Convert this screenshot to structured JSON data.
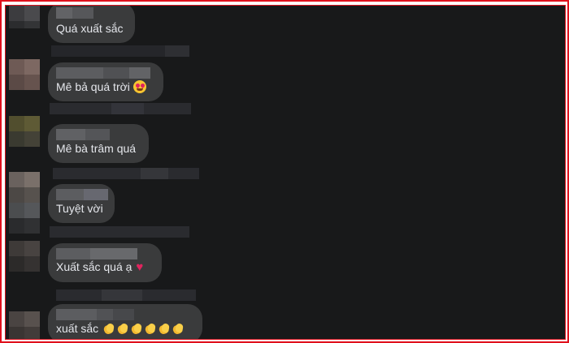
{
  "comments": [
    {
      "text": "Quá xuất sắc"
    },
    {
      "text": "Mê bả quá trời",
      "emoji": "star-struck-emoji"
    },
    {
      "text": "Mê bà trâm quá"
    },
    {
      "text": "Tuyệt vời"
    },
    {
      "text": "Xuất sắc quá ạ",
      "emoji": "red-heart-emoji",
      "heart": "♥"
    },
    {
      "text": "xuất sắc",
      "emoji": "clapping-hands-emoji"
    }
  ],
  "colors": {
    "background": "#18191a",
    "bubble": "#3a3b3c",
    "text": "#e4e6eb",
    "frame_border": "#e0101c"
  }
}
